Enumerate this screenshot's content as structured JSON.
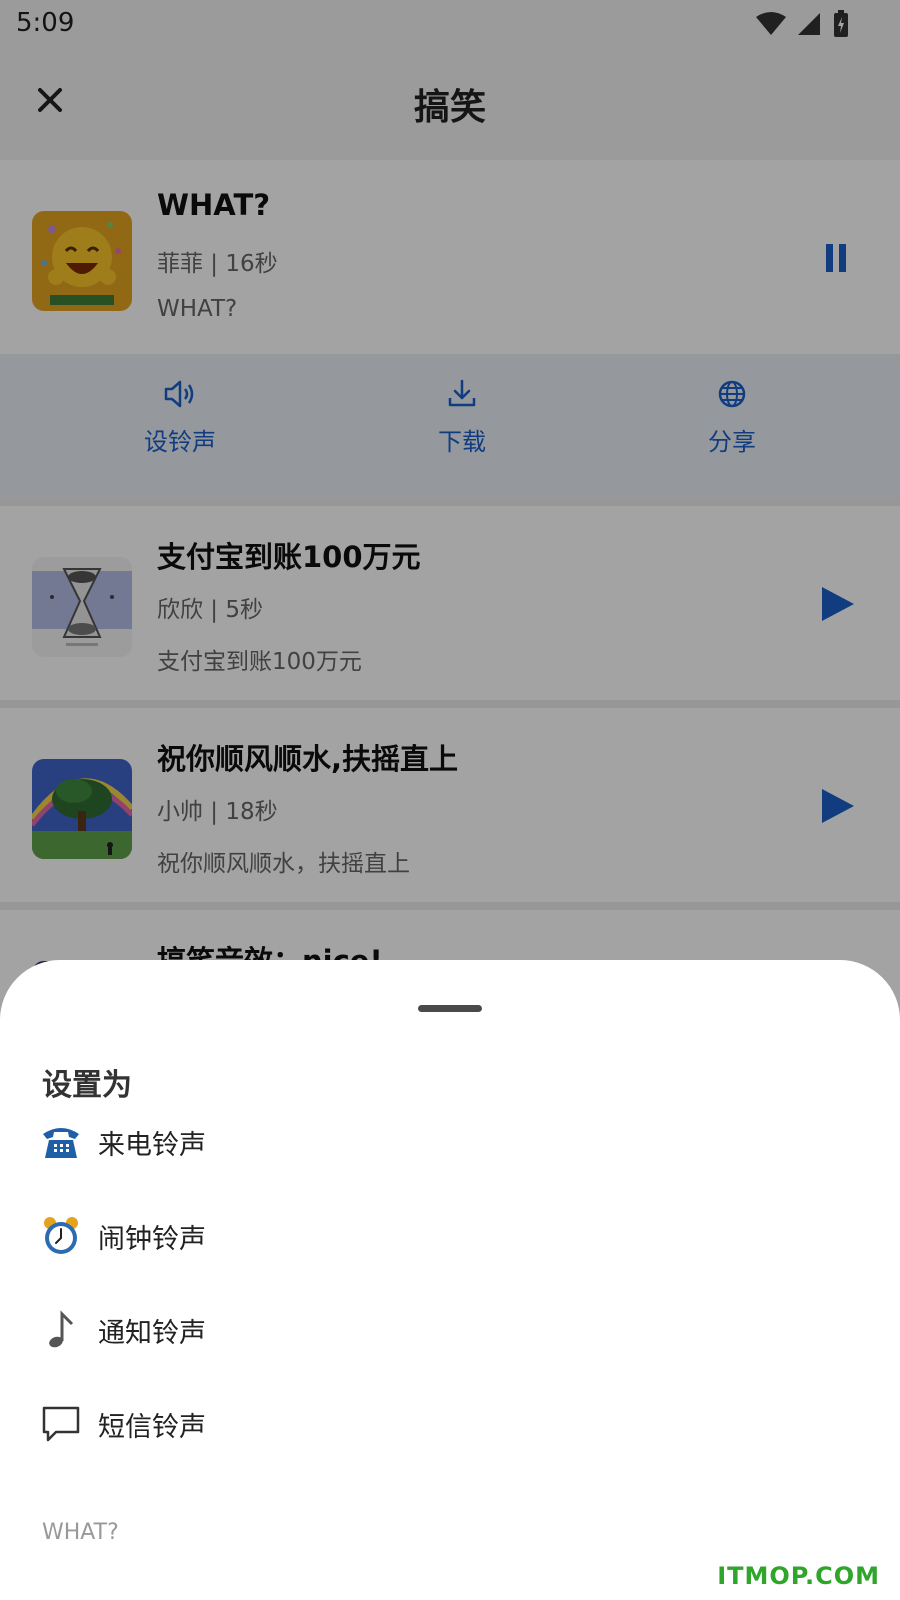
{
  "status": {
    "time": "5:09"
  },
  "header": {
    "title": "搞笑"
  },
  "items": [
    {
      "title": "WHAT?",
      "meta": "菲菲 | 16秒",
      "desc": "WHAT?",
      "state": "playing"
    },
    {
      "title": "支付宝到账100万元",
      "meta": "欣欣 | 5秒",
      "desc": "支付宝到账100万元",
      "state": "paused"
    },
    {
      "title": "祝你顺风顺水,扶摇直上",
      "meta": "小帅 | 18秒",
      "desc": "祝你顺风顺水，扶摇直上",
      "state": "paused"
    },
    {
      "title": "搞笑音效：nice!"
    }
  ],
  "actions": {
    "ringtone": "设铃声",
    "download": "下载",
    "share": "分享"
  },
  "sheet": {
    "title": "设置为",
    "options": [
      {
        "label": "来电铃声",
        "icon": "telephone-icon"
      },
      {
        "label": "闹钟铃声",
        "icon": "alarm-clock-icon"
      },
      {
        "label": "通知铃声",
        "icon": "music-note-icon"
      },
      {
        "label": "短信铃声",
        "icon": "message-bubble-icon"
      }
    ],
    "footer": "WHAT?"
  },
  "watermark": "ITMOP.COM",
  "colors": {
    "accent": "#1c5fc8",
    "scrim": "rgba(0,0,0,0.36)",
    "watermark": "#2fa52b"
  }
}
